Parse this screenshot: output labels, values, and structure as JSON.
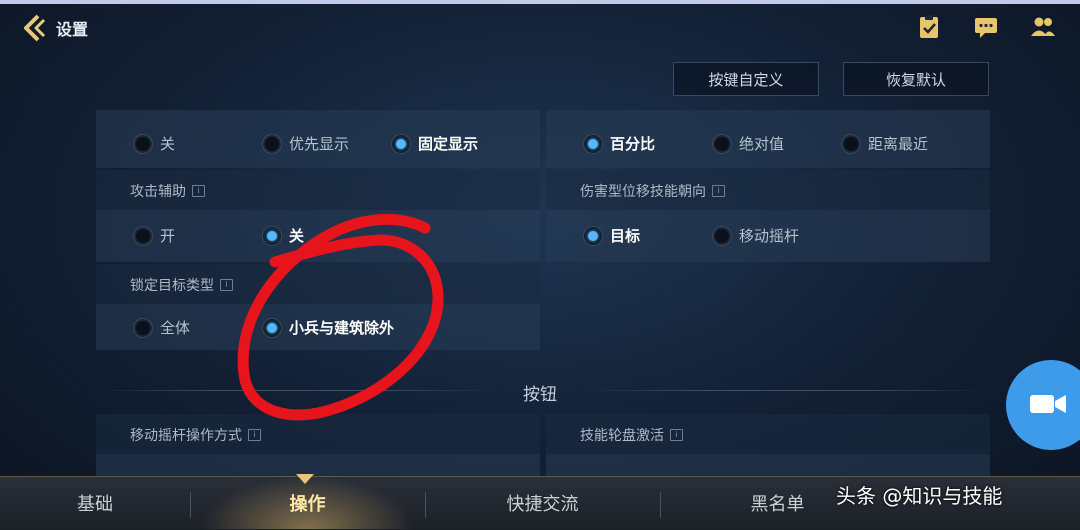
{
  "header": {
    "title": "设置",
    "back_icon": "chevron-left-icon",
    "icons": [
      "clipboard-check-icon",
      "chat-bubble-icon",
      "friends-icon"
    ]
  },
  "top_buttons": {
    "custom_keys": "按键自定义",
    "restore_default": "恢复默认"
  },
  "row1_left": {
    "options": [
      "关",
      "优先显示",
      "固定显示"
    ],
    "selected": "固定显示"
  },
  "row1_right": {
    "options": [
      "百分比",
      "绝对值",
      "距离最近"
    ],
    "selected": "百分比"
  },
  "attack_assist": {
    "label": "攻击辅助",
    "options": [
      "开",
      "关"
    ],
    "selected": "关"
  },
  "damage_skill_direction": {
    "label": "伤害型位移技能朝向",
    "options": [
      "目标",
      "移动摇杆"
    ],
    "selected": "目标"
  },
  "lock_target_type": {
    "label": "锁定目标类型",
    "options": [
      "全体",
      "小兵与建筑除外"
    ],
    "selected": "小兵与建筑除外"
  },
  "section": {
    "buttons_title": "按钮"
  },
  "move_joystick": {
    "label": "移动摇杆操作方式"
  },
  "skill_wheel": {
    "label": "技能轮盘激活"
  },
  "bottom_nav": {
    "tabs": [
      "基础",
      "操作",
      "快捷交流",
      "黑名单"
    ],
    "active": "操作"
  },
  "watermark": "头条 @知识与技能",
  "colors": {
    "accent_blue": "#55b8ff",
    "active_tab": "#ffe7a8",
    "camera_button": "#3e9bea",
    "annotation_red": "#e8141c"
  }
}
